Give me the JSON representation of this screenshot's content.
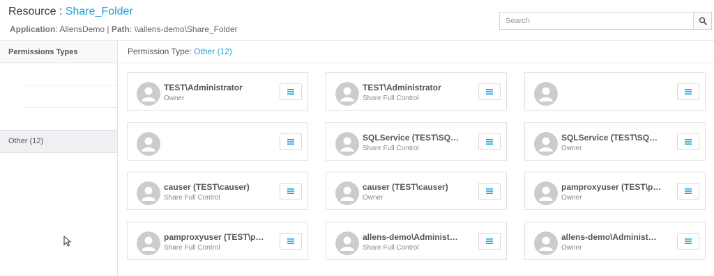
{
  "header": {
    "resource_label": "Resource :",
    "resource_name": "Share_Folder",
    "application_label": "Application",
    "application_value": "AllensDemo",
    "separator": "|",
    "path_label": "Path",
    "path_value": "\\\\allens-demo\\Share_Folder"
  },
  "search": {
    "placeholder": "Search",
    "value": "",
    "icon": "search-icon"
  },
  "sidebar": {
    "header": "Permissions Types",
    "items": [
      {
        "label": "Other (12)",
        "selected": true
      }
    ]
  },
  "main": {
    "permission_type_label": "Permission Type:",
    "permission_type_value": "Other (12)"
  },
  "cards": [
    {
      "name": "TEST\\Administrator",
      "role": "Owner"
    },
    {
      "name": "TEST\\Administrator",
      "role": "Share Full Control"
    },
    {
      "name": "",
      "role": ""
    },
    {
      "name": "",
      "role": ""
    },
    {
      "name": "SQLService (TEST\\SQ…",
      "role": "Share Full Control"
    },
    {
      "name": "SQLService (TEST\\SQ…",
      "role": "Owner"
    },
    {
      "name": "causer (TEST\\causer)",
      "role": "Share Full Control"
    },
    {
      "name": "causer (TEST\\causer)",
      "role": "Owner"
    },
    {
      "name": "pamproxyuser (TEST\\p…",
      "role": "Owner"
    },
    {
      "name": "pamproxyuser (TEST\\p…",
      "role": "Share Full Control"
    },
    {
      "name": "allens-demo\\Administ…",
      "role": "Share Full Control"
    },
    {
      "name": "allens-demo\\Administ…",
      "role": "Owner"
    }
  ],
  "colors": {
    "accent": "#1aa3d9",
    "avatar": "#cccccc",
    "selected_bg": "#eef0f4"
  }
}
